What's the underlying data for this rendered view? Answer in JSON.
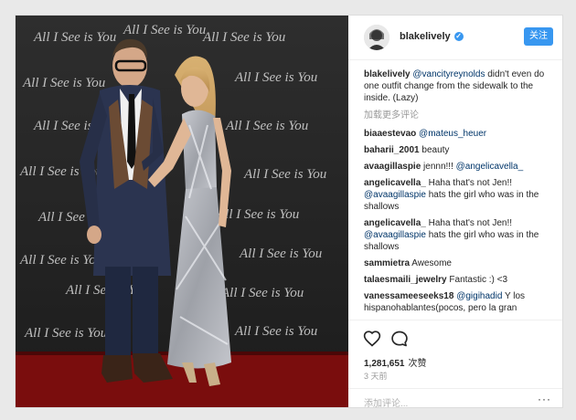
{
  "post": {
    "username": "blakelively",
    "follow_label": "关注",
    "caption_user": "blakelively",
    "caption_mention": "@vancityreynolds",
    "caption_text": " didn't even do one outfit change from the sidewalk to the inside. (Lazy)",
    "load_more": "加载更多评论",
    "likes_count": "1,281,651",
    "likes_label": "次赞",
    "time_ago": "3 天前",
    "add_comment_placeholder": "添加评论...",
    "more_icon": "···"
  },
  "photo": {
    "backdrop_text": "All I See is You"
  },
  "comments": [
    {
      "user": "biaaestevao",
      "mention": "@mateus_heuer",
      "text": ""
    },
    {
      "user": "baharii_2001",
      "mention": "",
      "text": " beauty"
    },
    {
      "user": "avaagillaspie",
      "pre": " jennn!!! ",
      "mention": "@angelicavella_",
      "text": ""
    },
    {
      "user": "angelicavella_",
      "pre": " Haha that's not Jen!! ",
      "mention": "@avaagillaspie",
      "text": " hats the girl who was in the shallows"
    },
    {
      "user": "angelicavella_",
      "pre": " Haha that's not Jen!! ",
      "mention": "@avaagillaspie",
      "text": " hats the girl who was in the shallows"
    },
    {
      "user": "sammietra",
      "mention": "",
      "text": " Awesome"
    },
    {
      "user": "talaesmaili_jewelry",
      "mention": "",
      "text": " Fantastic :) <3"
    },
    {
      "user": "vanessameeseeks18",
      "pre": " ",
      "mention": "@gigihadid",
      "text": " Y los hispanohablantes(pocos, pero la gran"
    }
  ],
  "colors": {
    "link": "#003569",
    "follow_button": "#3897f0",
    "muted": "#999999",
    "red_carpet": "#7a0d0d"
  },
  "icons": [
    "verified-badge-icon",
    "heart-icon",
    "comment-icon",
    "more-options-icon"
  ]
}
